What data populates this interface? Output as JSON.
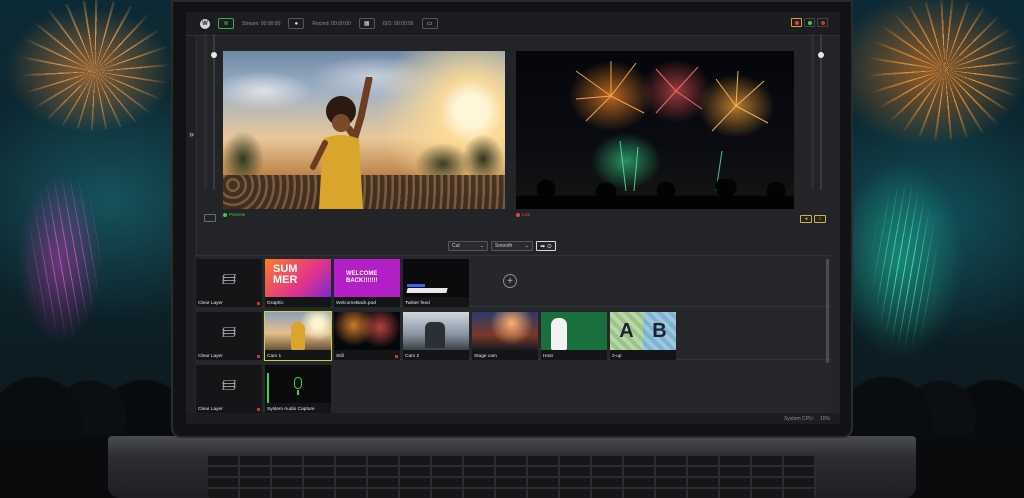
{
  "topbar": {
    "stream_label": "Stream: 00:00:00",
    "record_label": "Record: 00:00:00",
    "iso_label": "ISO: 00:00:00",
    "logo": "W"
  },
  "preview": {
    "label": "Preview"
  },
  "program": {
    "label": "Live"
  },
  "transition": {
    "type": "Cut",
    "speed": "Smooth",
    "go_symbol": "➡ ⊙"
  },
  "layers": [
    {
      "tiles": [
        {
          "name": "Clear Layer",
          "kind": "clear"
        },
        {
          "name": "Graphic",
          "kind": "summer",
          "text_a": "SUM",
          "text_b": "MER"
        },
        {
          "name": "WelcomeBack.pod",
          "kind": "welcome",
          "text_a": "WELCOME",
          "text_b": "BACK!!!!!!!"
        },
        {
          "name": "Twitter feed",
          "kind": "twitter"
        }
      ]
    },
    {
      "tiles": [
        {
          "name": "Clear Layer",
          "kind": "clear"
        },
        {
          "name": "Cam 1",
          "kind": "cam1",
          "selected": true
        },
        {
          "name": "Still",
          "kind": "still"
        },
        {
          "name": "Cam 2",
          "kind": "cam2"
        },
        {
          "name": "Stage cam",
          "kind": "stage"
        },
        {
          "name": "Host",
          "kind": "host"
        },
        {
          "name": "2-up",
          "kind": "twoup",
          "text_a": "A",
          "text_b": "B"
        }
      ]
    },
    {
      "tiles": [
        {
          "name": "Clear Layer",
          "kind": "clear"
        },
        {
          "name": "System Audio Capture",
          "kind": "audio"
        }
      ]
    }
  ],
  "status": {
    "cpu_label": "System CPU:",
    "cpu_value": "10%"
  },
  "colors": {
    "selected": "#c8d43a",
    "preview": "#49c249",
    "live": "#e04848",
    "accent": "#d5b135"
  }
}
